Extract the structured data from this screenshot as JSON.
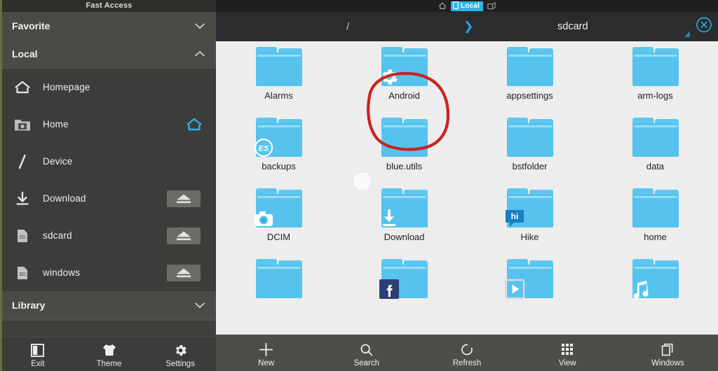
{
  "sidebar": {
    "title": "Fast Access",
    "groups": [
      {
        "label": "Favorite",
        "icon": "chevron-down-icon",
        "expanded": false
      },
      {
        "label": "Local",
        "icon": "chevron-up-icon",
        "expanded": true
      },
      {
        "label": "Library",
        "icon": "chevron-down-icon",
        "expanded": false
      }
    ],
    "items": [
      {
        "label": "Homepage",
        "icon": "house-outline-icon",
        "action": ""
      },
      {
        "label": "Home",
        "icon": "folder-camera-icon",
        "action": "home-accent-icon"
      },
      {
        "label": "Device",
        "icon": "slash-root-icon",
        "action": ""
      },
      {
        "label": "Download",
        "icon": "download-icon",
        "action": "eject-icon"
      },
      {
        "label": "sdcard",
        "icon": "sd-card-icon",
        "action": "eject-icon"
      },
      {
        "label": "windows",
        "icon": "sd-card-icon",
        "action": "eject-icon"
      }
    ],
    "bottom_buttons": [
      {
        "label": "Exit",
        "icon": "exit-panel-icon"
      },
      {
        "label": "Theme",
        "icon": "tshirt-icon"
      },
      {
        "label": "Settings",
        "icon": "gear-icon"
      }
    ]
  },
  "topbar": {
    "home_icon": "home-small-icon",
    "active_tab": "Local",
    "active_tab_icon": "device-icon",
    "remote_icon": "network-device-icon"
  },
  "pathbar": {
    "menu_icon": "hamburger-menu-icon",
    "root": "/",
    "separator": "❯",
    "current": "sdcard",
    "close_icon": "close-circle-icon"
  },
  "files": [
    {
      "name": "Alarms",
      "badge": "none"
    },
    {
      "name": "Android",
      "badge": "gear-icon",
      "annotated": true
    },
    {
      "name": "appsettings",
      "badge": "none"
    },
    {
      "name": "arm-logs",
      "badge": "none"
    },
    {
      "name": "backups",
      "badge": "es-file-explorer-icon"
    },
    {
      "name": "blue.utils",
      "badge": "none"
    },
    {
      "name": "bstfolder",
      "badge": "none"
    },
    {
      "name": "data",
      "badge": "none"
    },
    {
      "name": "DCIM",
      "badge": "camera-icon"
    },
    {
      "name": "Download",
      "badge": "download-arrow-icon"
    },
    {
      "name": "Hike",
      "badge": "hike-icon"
    },
    {
      "name": "home",
      "badge": "none"
    },
    {
      "name": "",
      "badge": "none"
    },
    {
      "name": "",
      "badge": "facebook-icon"
    },
    {
      "name": "",
      "badge": "video-play-icon"
    },
    {
      "name": "",
      "badge": "music-note-icon"
    }
  ],
  "toolbar": [
    {
      "label": "New",
      "icon": "plus-icon"
    },
    {
      "label": "Search",
      "icon": "magnifier-icon"
    },
    {
      "label": "Refresh",
      "icon": "refresh-icon"
    },
    {
      "label": "View",
      "icon": "grid-view-icon"
    },
    {
      "label": "Windows",
      "icon": "windows-stack-icon"
    }
  ],
  "colors": {
    "accent_blue": "#29b6e8",
    "folder_blue": "#55c3ee",
    "sidebar_bg": "#3c3c3a",
    "annotation_red": "#cc2222",
    "grid_bg": "#ededed"
  }
}
